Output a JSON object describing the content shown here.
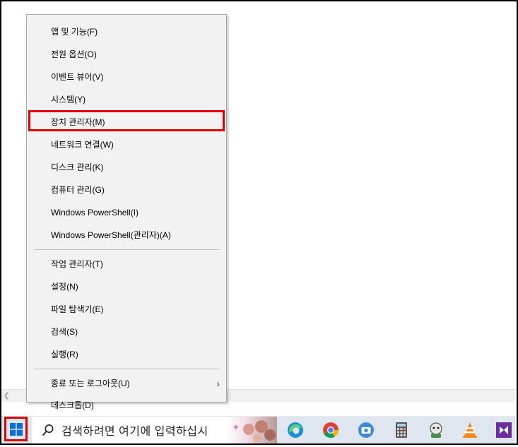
{
  "context_menu": {
    "group1": [
      "앱 및 기능(F)",
      "전원 옵션(O)",
      "이벤트 뷰어(V)",
      "시스템(Y)",
      "장치 관리자(M)",
      "네트워크 연결(W)",
      "디스크 관리(K)",
      "컴퓨터 관리(G)",
      "Windows PowerShell(I)",
      "Windows PowerShell(관리자)(A)"
    ],
    "group2": [
      "작업 관리자(T)",
      "설정(N)",
      "파일 탐색기(E)",
      "검색(S)",
      "실행(R)"
    ],
    "group3": [
      "종료 또는 로그아웃(U)",
      "데스크톱(D)"
    ],
    "highlighted_item": "장치 관리자(M)"
  },
  "taskbar": {
    "search_placeholder": "검색하려면 여기에 입력하십시",
    "pinned_icons": [
      "edge-icon",
      "chrome-icon",
      "camera-app-icon",
      "calculator-icon",
      "app-icon",
      "vlc-icon",
      "visual-studio-icon"
    ]
  },
  "colors": {
    "highlight": "#e00000",
    "menu_bg": "#f2f2f2",
    "taskbar_bg": "#dfe6ee"
  }
}
